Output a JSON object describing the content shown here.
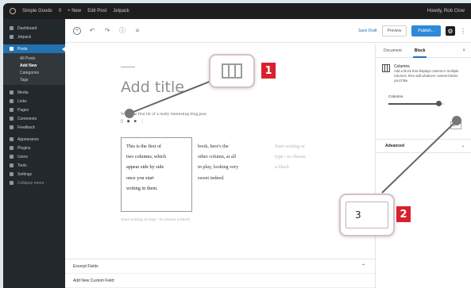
{
  "admin_bar": {
    "site": "Simple Goods",
    "comments": "0",
    "new": "+ New",
    "edit": "Edit Post",
    "extra": "Jetpack",
    "howdy": "Howdy, Rob Clow"
  },
  "sidebar": {
    "items": [
      {
        "label": "Dashboard",
        "active": false
      },
      {
        "label": "Jetpack",
        "active": false
      },
      {
        "label": "Posts",
        "active": true
      }
    ],
    "posts_sub": [
      "All Posts",
      "Add New",
      "Categories",
      "Tags"
    ],
    "items_after": [
      "Media",
      "Links",
      "Pages",
      "Comments",
      "Feedback",
      "Appearance",
      "Plugins",
      "Users",
      "Tools",
      "Settings"
    ],
    "collapse": "Collapse menu"
  },
  "toolbar": {
    "add": "+",
    "undo": "↶",
    "redo": "↷",
    "info": "ⓘ",
    "nav": "≡",
    "save_draft": "Save Draft",
    "preview": "Preview",
    "publish": "Publish...",
    "settings": "⚙",
    "more": "⋮"
  },
  "editor": {
    "title_placeholder": "Add title",
    "first_line": "Write the first bit of a really interesting blog post",
    "block_toolbar": [
      "▯",
      "◆",
      "■",
      "⋮"
    ],
    "columns": [
      [
        "This is the first of",
        "two columns, which",
        "appear side by side",
        "once you start",
        "writing in them."
      ],
      [
        "book, here's the",
        "other column, at all",
        "in play, looking very",
        "sweet indeed."
      ],
      [
        "Start writing or",
        "type / to choose",
        "a block"
      ]
    ],
    "appender": "Start writing or type / to choose a block"
  },
  "inspector": {
    "tabs": [
      "Document",
      "Block"
    ],
    "active_tab": "Block",
    "close": "×",
    "card_title": "Columns",
    "card_desc": "Add a block that displays content in multiple columns, then add whatever content blocks you'd like.",
    "control_label": "Columns",
    "slider_fraction": 0.95,
    "number_small": "3",
    "advanced": "Advanced",
    "advanced_chev": "⌄"
  },
  "meta": [
    {
      "label": "Excerpt Fields",
      "chev": "⌃"
    },
    {
      "label": "Add New Custom Field:",
      "chev": ""
    }
  ],
  "callouts": {
    "badge_1": "1",
    "badge_2": "2",
    "number_value": "3"
  },
  "colors": {
    "accent": "#2271b1",
    "badge": "#d9212e",
    "sidebar": "#23282d"
  }
}
